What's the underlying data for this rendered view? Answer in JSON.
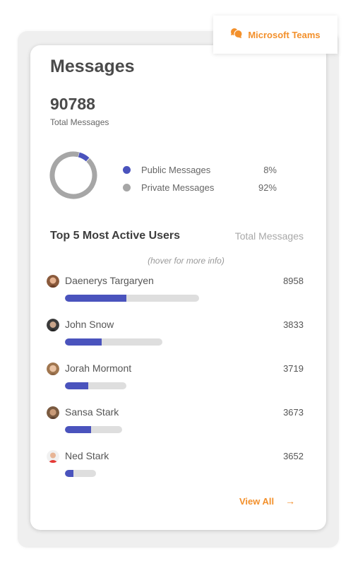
{
  "badge": {
    "label": "Microsoft Teams",
    "icon": "chat-bubbles-icon"
  },
  "card": {
    "title": "Messages",
    "total": {
      "value": "90788",
      "label": "Total Messages"
    },
    "breakdown": [
      {
        "label": "Public Messages",
        "percent": "8%",
        "value": 8,
        "color": "#4a53bd"
      },
      {
        "label": "Private Messages",
        "percent": "92%",
        "value": 92,
        "color": "#a6a6a6"
      }
    ],
    "top_users": {
      "title": "Top 5 Most Active Users",
      "column_header": "Total Messages",
      "hint": "(hover for more info)",
      "users": [
        {
          "name": "Daenerys Targaryen",
          "count": "8958",
          "bar_fraction": 0.46,
          "avatar": "avatar-icon"
        },
        {
          "name": "John Snow",
          "count": "3833",
          "bar_fraction": 0.38,
          "avatar": "avatar-icon"
        },
        {
          "name": "Jorah Mormont",
          "count": "3719",
          "bar_fraction": 0.38,
          "avatar": "avatar-icon"
        },
        {
          "name": "Sansa Stark",
          "count": "3673",
          "bar_fraction": 0.46,
          "avatar": "avatar-icon"
        },
        {
          "name": "Ned Stark",
          "count": "3652",
          "bar_fraction": 0.27,
          "avatar": "avatar-icon"
        }
      ]
    },
    "view_all": {
      "label": "View All",
      "icon": "arrow-right-icon"
    }
  },
  "colors": {
    "accent": "#f3902b",
    "bar_fill": "#4a53bd",
    "bar_track": "#dedede"
  }
}
